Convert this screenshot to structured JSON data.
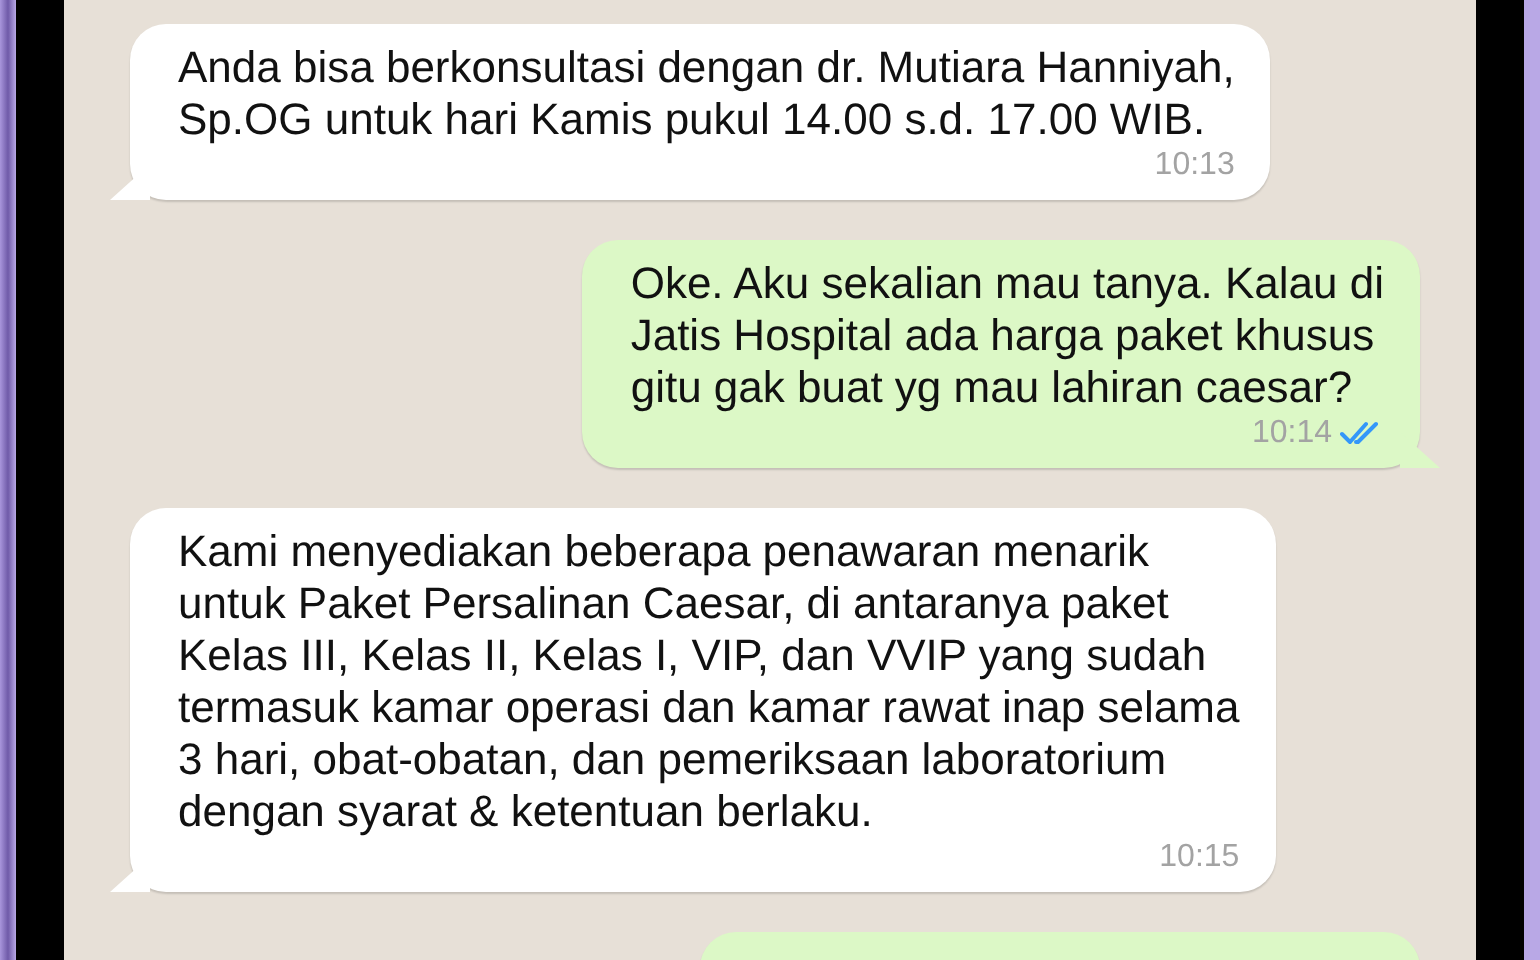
{
  "messages": [
    {
      "kind": "incoming",
      "text": "Anda bisa berkonsultasi dengan dr. Mutiara Hanniyah,\nSp.OG untuk hari Kamis pukul 14.00 s.d. 17.00 WIB.",
      "time": "10:13"
    },
    {
      "kind": "outgoing",
      "text": "Oke. Aku sekalian mau tanya. Kalau di\nJatis Hospital ada harga paket khusus\ngitu gak buat yg mau lahiran caesar?",
      "time": "10:14",
      "read": true
    },
    {
      "kind": "incoming",
      "text": "Kami menyediakan beberapa penawaran menarik\nuntuk Paket Persalinan Caesar, di antaranya paket\nKelas III, Kelas II, Kelas I, VIP, dan VVIP yang sudah\ntermasuk kamar operasi dan kamar rawat inap selama\n3 hari, obat-obatan, dan pemeriksaan laboratorium\ndengan syarat & ketentuan berlaku.",
      "time": "10:15"
    },
    {
      "kind": "outgoing"
    }
  ]
}
